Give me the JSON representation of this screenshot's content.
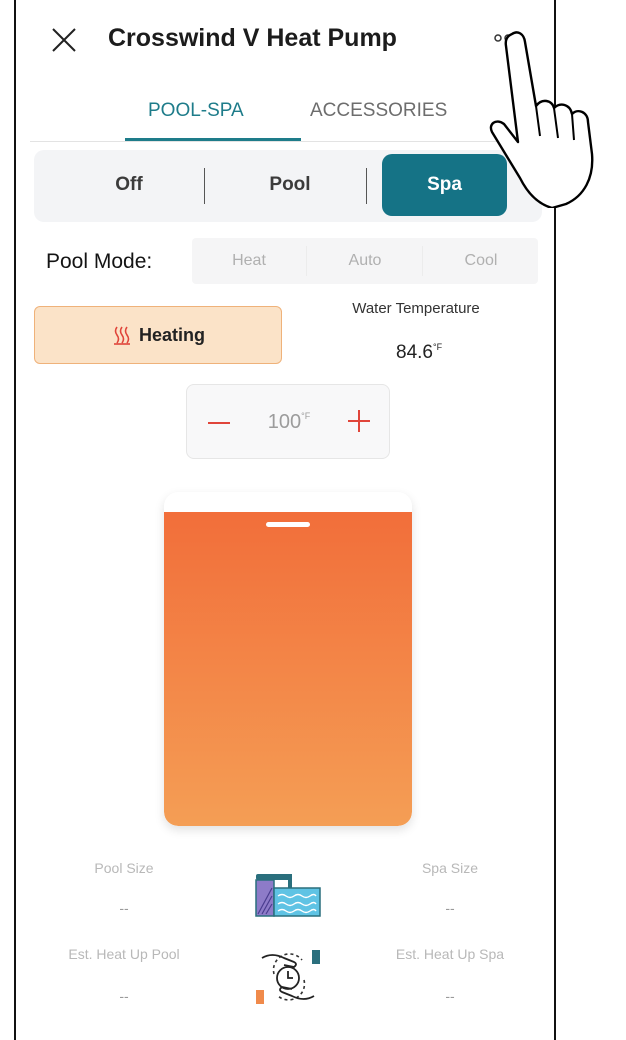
{
  "header": {
    "title": "Crosswind V Heat Pump"
  },
  "tabs": [
    {
      "label": "POOL-SPA",
      "active": true
    },
    {
      "label": "ACCESSORIES",
      "active": false
    }
  ],
  "segmented": {
    "items": [
      "Off",
      "Pool",
      "Spa"
    ],
    "selected": "Spa"
  },
  "pool_mode": {
    "label": "Pool Mode:",
    "options": [
      "Heat",
      "Auto",
      "Cool"
    ]
  },
  "status": {
    "label": "Heating"
  },
  "water_temperature": {
    "label": "Water Temperature",
    "value": "84.6",
    "unit": "°F"
  },
  "setpoint": {
    "value": "100",
    "unit": "°F"
  },
  "tank": {
    "fill_fraction": 0.94
  },
  "stats": {
    "pool_size": {
      "label": "Pool Size",
      "value": "--"
    },
    "spa_size": {
      "label": "Spa Size",
      "value": "--"
    },
    "heat_up_pool": {
      "label": "Est. Heat Up Pool",
      "value": "--"
    },
    "heat_up_spa": {
      "label": "Est. Heat Up Spa",
      "value": "--"
    }
  },
  "colors": {
    "accent": "#157386",
    "heating_bg": "#fbe3c8",
    "fill_top": "#f26e3a",
    "fill_bottom": "#f49e55",
    "minus_plus": "#e0453a"
  },
  "icons": [
    "close-icon",
    "more-icon",
    "heat-waves-icon",
    "minus-icon",
    "plus-icon",
    "pool-spa-icon",
    "heat-time-icon",
    "hand-pointer-icon"
  ]
}
